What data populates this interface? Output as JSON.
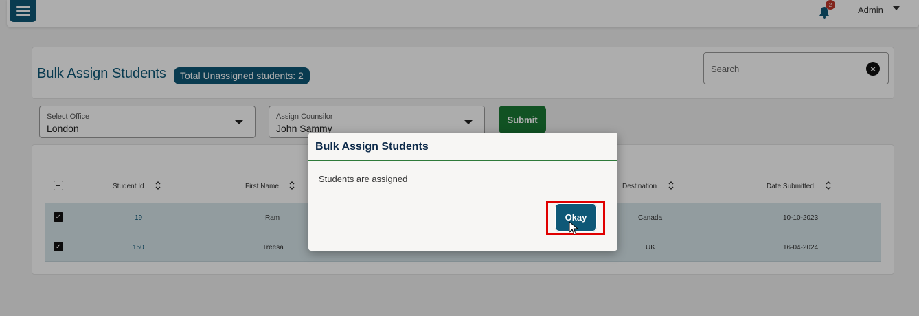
{
  "topbar": {
    "notification_count": "2",
    "user_label": "Admin"
  },
  "header": {
    "title": "Bulk Assign Students",
    "unassigned_badge": "Total Unassigned students: 2",
    "search_placeholder": "Search"
  },
  "filters": {
    "office": {
      "label": "Select Office",
      "value": "London"
    },
    "counselor": {
      "label": "Assign Counsilor",
      "value": "John Sammy"
    },
    "submit_label": "Submit"
  },
  "table": {
    "columns": [
      "Student Id",
      "First Name",
      "Destination",
      "Date Submitted"
    ],
    "rows": [
      {
        "student_id": "19",
        "first_name": "Ram",
        "destination": "Canada",
        "date_submitted": "10-10-2023"
      },
      {
        "student_id": "150",
        "first_name": "Treesa",
        "destination": "UK",
        "date_submitted": "16-04-2024"
      }
    ]
  },
  "modal": {
    "title": "Bulk Assign Students",
    "message": "Students are assigned",
    "okay_label": "Okay"
  },
  "colors": {
    "primary": "#0e5877",
    "success": "#1a7a34",
    "highlight": "#e00000",
    "badge": "#c0392b"
  }
}
